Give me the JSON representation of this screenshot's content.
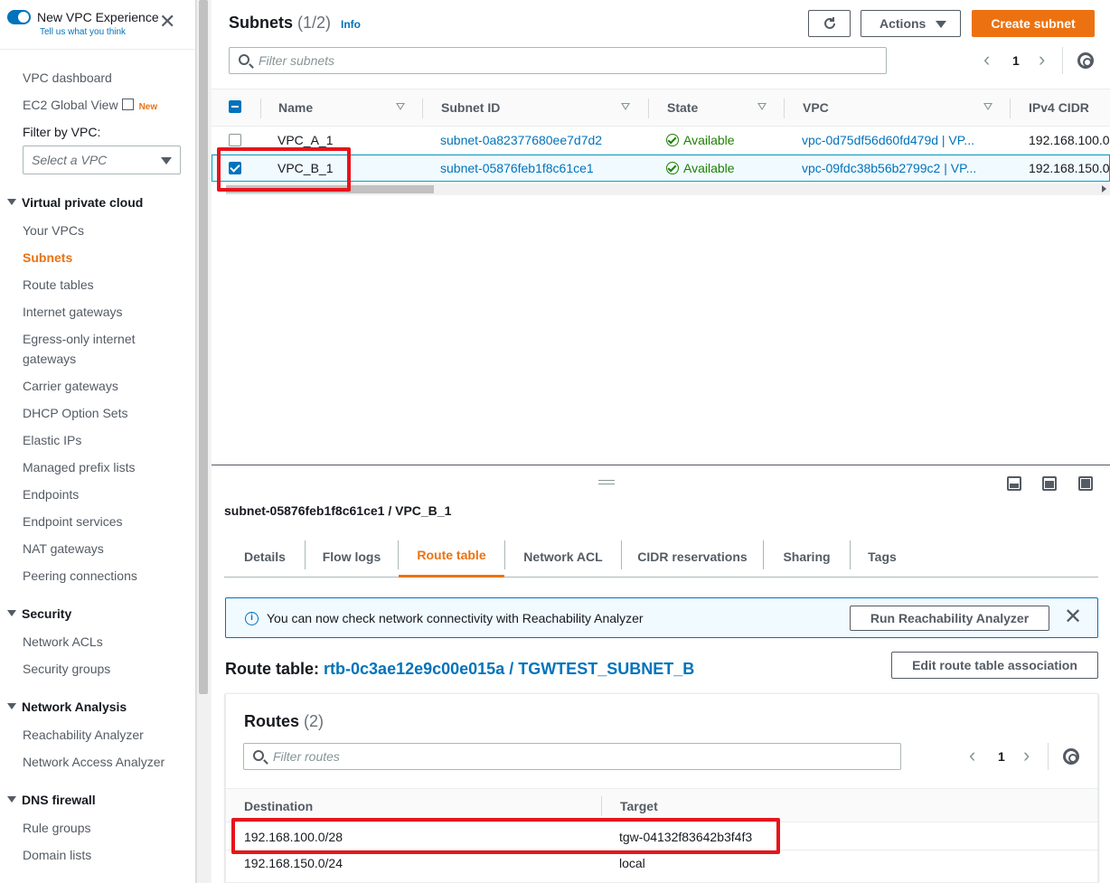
{
  "sidebar": {
    "experience_title": "New VPC Experience",
    "experience_sub": "Tell us what you think",
    "items_top": [
      "VPC dashboard",
      "EC2 Global View"
    ],
    "new_badge": "New",
    "filter_label": "Filter by VPC:",
    "filter_placeholder": "Select a VPC",
    "sections": [
      {
        "title": "Virtual private cloud",
        "items": [
          "Your VPCs",
          "Subnets",
          "Route tables",
          "Internet gateways",
          "Egress-only internet",
          "gateways",
          "Carrier gateways",
          "DHCP Option Sets",
          "Elastic IPs",
          "Managed prefix lists",
          "Endpoints",
          "Endpoint services",
          "NAT gateways",
          "Peering connections"
        ]
      },
      {
        "title": "Security",
        "items": [
          "Network ACLs",
          "Security groups"
        ]
      },
      {
        "title": "Network Analysis",
        "items": [
          "Reachability Analyzer",
          "Network Access Analyzer"
        ]
      },
      {
        "title": "DNS firewall",
        "items": [
          "Rule groups",
          "Domain lists"
        ]
      }
    ],
    "active_item": "Subnets"
  },
  "subnets": {
    "title": "Subnets",
    "count": "(1/2)",
    "info": "Info",
    "actions_label": "Actions",
    "create_label": "Create subnet",
    "search_placeholder": "Filter subnets",
    "page": "1",
    "columns": [
      "Name",
      "Subnet ID",
      "State",
      "VPC",
      "IPv4 CIDR"
    ],
    "rows": [
      {
        "name": "VPC_A_1",
        "subnet_id": "subnet-0a82377680ee7d7d2",
        "state": "Available",
        "vpc": "vpc-0d75df56d60fd479d | VP...",
        "cidr": "192.168.100.0",
        "selected": false
      },
      {
        "name": "VPC_B_1",
        "subnet_id": "subnet-05876feb1f8c61ce1",
        "state": "Available",
        "vpc": "vpc-09fdc38b56b2799c2 | VP...",
        "cidr": "192.168.150.0",
        "selected": true
      }
    ]
  },
  "details": {
    "title": "subnet-05876feb1f8c61ce1 / VPC_B_1",
    "tabs": [
      "Details",
      "Flow logs",
      "Route table",
      "Network ACL",
      "CIDR reservations",
      "Sharing",
      "Tags"
    ],
    "active_tab": "Route table",
    "flash_text": "You can now check network connectivity with Reachability Analyzer",
    "flash_button": "Run Reachability Analyzer",
    "route_table_label": "Route table:",
    "route_table_link": "rtb-0c3ae12e9c00e015a / TGWTEST_SUBNET_B",
    "edit_button": "Edit route table association",
    "routes_title": "Routes",
    "routes_count": "(2)",
    "routes_placeholder": "Filter routes",
    "routes_page": "1",
    "routes_columns": [
      "Destination",
      "Target"
    ],
    "routes": [
      {
        "destination": "192.168.100.0/28",
        "target": "tgw-04132f83642b3f4f3"
      },
      {
        "destination": "192.168.150.0/24",
        "target": "local"
      }
    ]
  },
  "colors": {
    "accent": "#ec7211",
    "link": "#0073bb",
    "highlight": "#e8141c",
    "success": "#1d8102"
  }
}
